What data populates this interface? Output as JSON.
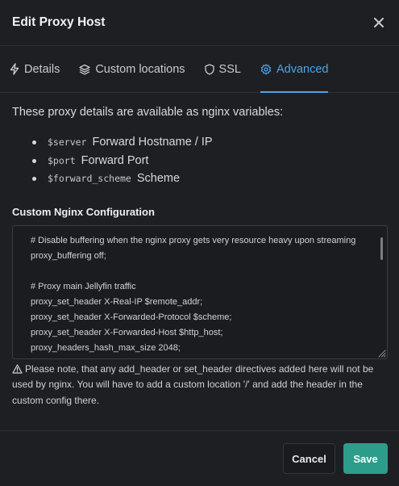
{
  "modal": {
    "title": "Edit Proxy Host"
  },
  "tabs": [
    {
      "label": "Details",
      "icon": "bolt-icon",
      "active": false
    },
    {
      "label": "Custom locations",
      "icon": "layers-icon",
      "active": false
    },
    {
      "label": "SSL",
      "icon": "shield-icon",
      "active": false
    },
    {
      "label": "Advanced",
      "icon": "gear-icon",
      "active": true
    }
  ],
  "advanced": {
    "intro": "These proxy details are available as nginx variables:",
    "variables": [
      {
        "name": "$server",
        "desc": "Forward Hostname / IP"
      },
      {
        "name": "$port",
        "desc": "Forward Port"
      },
      {
        "name": "$forward_scheme",
        "desc": "Scheme"
      }
    ],
    "config_label": "Custom Nginx Configuration",
    "config_lines": [
      "# Disable buffering when the nginx proxy gets very resource heavy upon streaming",
      "proxy_buffering off;",
      "",
      "# Proxy main Jellyfin traffic",
      "proxy_set_header X-Real-IP $remote_addr;",
      "proxy_set_header X-Forwarded-Protocol $scheme;",
      "proxy_set_header X-Forwarded-Host $http_host;",
      "proxy_headers_hash_max_size 2048;"
    ],
    "note_line1": "Please note, that any add_header or set_header directives added here will not be",
    "note_line2": "used by nginx. You will have to add a custom location '/' and add the header in the",
    "note_line3": "custom config there."
  },
  "footer": {
    "cancel_label": "Cancel",
    "save_label": "Save"
  },
  "colors": {
    "accent": "#4ea4e6",
    "save": "#2c9d8a",
    "background": "#1e1f22"
  }
}
